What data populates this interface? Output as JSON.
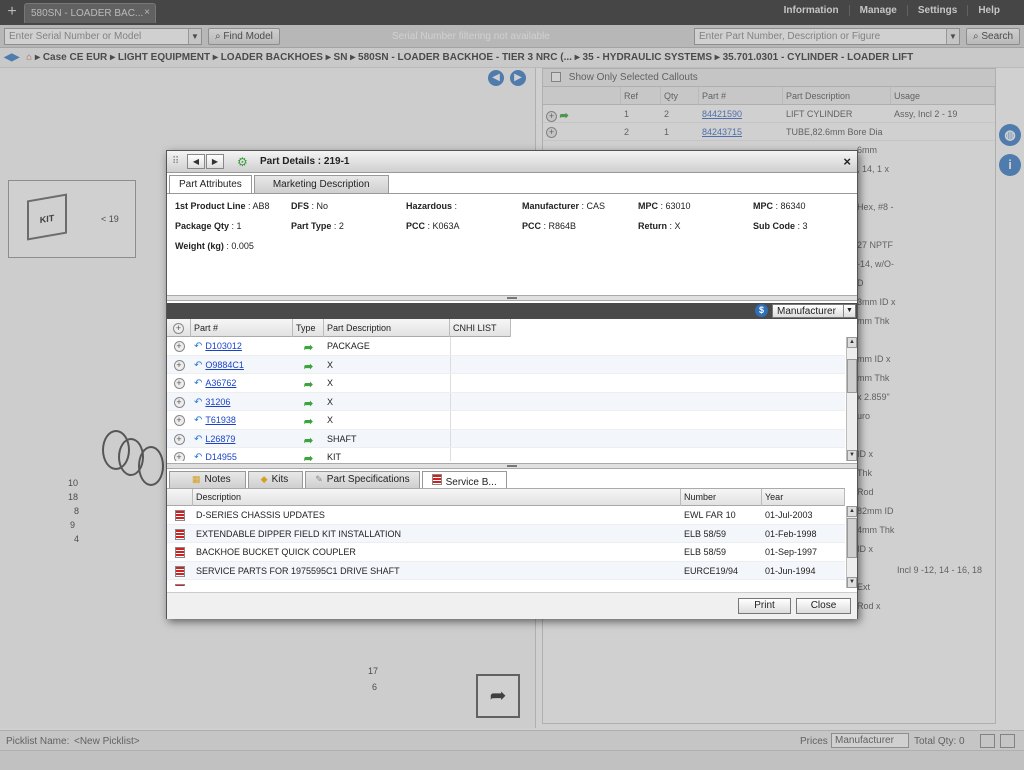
{
  "topbar": {
    "app_tab": "580SN - LOADER BAC...",
    "menu": [
      "Information",
      "Manage",
      "Settings",
      "Help"
    ]
  },
  "searchbar": {
    "serial_placeholder": "Enter Serial Number or Model",
    "find_model": "Find Model",
    "notice": "Serial Number filtering not available",
    "part_placeholder": "Enter Part Number, Description or Figure",
    "search": "Search"
  },
  "breadcrumb": [
    "Case CE EUR",
    "LIGHT EQUIPMENT",
    "LOADER BACKHOES",
    "SN",
    "580SN - LOADER BACKHOE - TIER 3 NRC (...",
    "35 - HYDRAULIC SYSTEMS",
    "35.701.0301 - CYLINDER - LOADER LIFT"
  ],
  "diagram": {
    "kit_label": "KIT",
    "kit_qty": "< 19",
    "callouts": [
      "10",
      "18",
      "8",
      "9",
      "4",
      "17",
      "6"
    ]
  },
  "parts_list": {
    "show_selected": "Show Only Selected Callouts",
    "columns": [
      "Ref",
      "Qty",
      "Part #",
      "Part Description",
      "Usage"
    ],
    "rows": [
      {
        "ref": "1",
        "qty": "2",
        "part": "84421590",
        "desc": "LIFT CYLINDER",
        "usage": "Assy, Incl 2 - 19"
      },
      {
        "ref": "2",
        "qty": "1",
        "part": "84243715",
        "desc": "TUBE,82.6mm Bore Dia",
        "usage": ""
      }
    ],
    "fragments": [
      {
        "text": "6mm",
        "row": 2
      },
      {
        "text": ", 14, 1 x",
        "row": 3
      },
      {
        "text": "Hex, #8 -",
        "row": 5
      },
      {
        "text": "27 NPTF",
        "row": 7
      },
      {
        "text": "-14, w/O-",
        "row": 8
      },
      {
        "text": "D",
        "row": 9
      },
      {
        "text": "3mm ID x",
        "row": 10
      },
      {
        "text": "mm Thk",
        "row": 11
      },
      {
        "text": "mm ID x",
        "row": 13
      },
      {
        "text": "mm Thk",
        "row": 14
      },
      {
        "text": "x 2.859\"",
        "row": 15
      },
      {
        "text": "uro",
        "row": 16
      },
      {
        "text": "ID x",
        "row": 18
      },
      {
        "text": "Thk",
        "row": 19
      },
      {
        "text": "Rod",
        "row": 20
      },
      {
        "text": "82mm ID",
        "row": 21
      },
      {
        "text": "4mm Thk",
        "row": 22
      },
      {
        "text": "ID x",
        "row": 23
      },
      {
        "text": "Ext",
        "row": 25
      },
      {
        "text": "Rod x",
        "row": 26
      }
    ],
    "last_usage": "Incl 9 -12, 14 - 16, 18"
  },
  "bottombar": {
    "picklist_label": "Picklist Name:",
    "picklist_value": "<New Picklist>",
    "prices_label": "Prices",
    "prices_value": "Manufacturer",
    "total_qty": "Total Qty: 0"
  },
  "dialog": {
    "title": "Part Details : 219-1",
    "close_symbol": "×",
    "tabs": [
      "Part Attributes",
      "Marketing Description"
    ],
    "attributes": [
      {
        "label": "1st Product Line",
        "value": "AB8"
      },
      {
        "label": "DFS",
        "value": "No"
      },
      {
        "label": "Hazardous",
        "value": ""
      },
      {
        "label": "Manufacturer",
        "value": "CAS"
      },
      {
        "label": "MPC",
        "value": "63010"
      },
      {
        "label": "MPC",
        "value": "86340"
      },
      {
        "label": "Package Qty",
        "value": "1"
      },
      {
        "label": "Part Type",
        "value": "2"
      },
      {
        "label": "PCC",
        "value": "K063A"
      },
      {
        "label": "PCC",
        "value": "R864B"
      },
      {
        "label": "Return",
        "value": "X"
      },
      {
        "label": "Sub Code",
        "value": "3"
      },
      {
        "label": "Weight (kg)",
        "value": "0.005"
      }
    ],
    "manufacturer_select": "Manufacturer",
    "dollar_symbol": "$",
    "grid_columns": [
      "Part #",
      "Type",
      "Part Description",
      "CNHI LIST"
    ],
    "grid_rows": [
      {
        "part": "D103012",
        "desc": "PACKAGE"
      },
      {
        "part": "O9884C1",
        "desc": "X"
      },
      {
        "part": "A36762",
        "desc": "X"
      },
      {
        "part": "31206",
        "desc": "X"
      },
      {
        "part": "T61938",
        "desc": "X"
      },
      {
        "part": "L26879",
        "desc": "SHAFT"
      },
      {
        "part": "D14955",
        "desc": "KIT"
      }
    ],
    "lower_tabs": [
      "Notes",
      "Kits",
      "Part Specifications",
      "Service B..."
    ],
    "sb_columns": [
      "Description",
      "Number",
      "Year"
    ],
    "sb_rows": [
      {
        "desc": "D-SERIES CHASSIS UPDATES",
        "number": "EWL FAR 10",
        "year": "01-Jul-2003"
      },
      {
        "desc": "EXTENDABLE DIPPER FIELD KIT INSTALLATION",
        "number": "ELB 58/59",
        "year": "01-Feb-1998"
      },
      {
        "desc": "BACKHOE BUCKET QUICK COUPLER",
        "number": "ELB 58/59",
        "year": "01-Sep-1997"
      },
      {
        "desc": "SERVICE PARTS FOR 1975595C1 DRIVE SHAFT",
        "number": "EURCE19/94",
        "year": "01-Jun-1994"
      },
      {
        "desc": "",
        "number": "",
        "year": ""
      }
    ],
    "print": "Print",
    "close": "Close"
  }
}
